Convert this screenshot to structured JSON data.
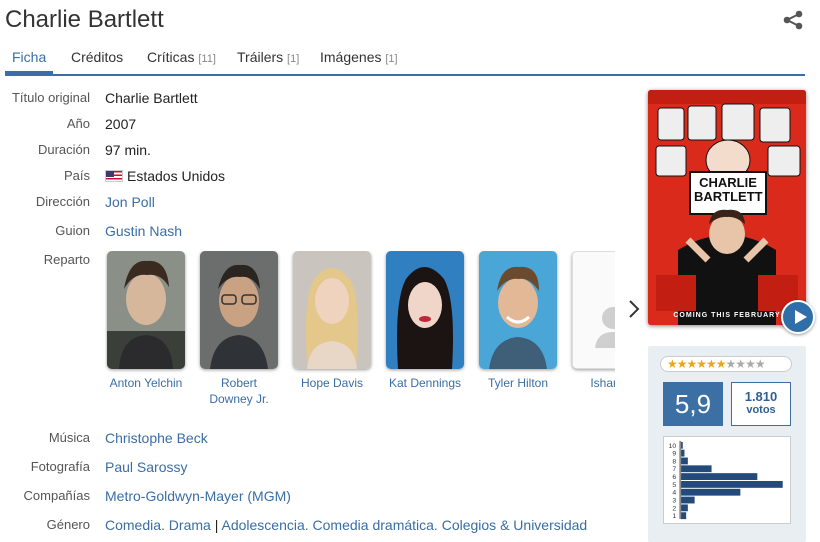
{
  "title": "Charlie Bartlett",
  "tabs": [
    {
      "label": "Ficha",
      "count": ""
    },
    {
      "label": "Créditos",
      "count": ""
    },
    {
      "label": "Críticas",
      "count": "[11]"
    },
    {
      "label": "Tráilers",
      "count": "[1]"
    },
    {
      "label": "Imágenes",
      "count": "[1]"
    }
  ],
  "fields": {
    "titulo_original": {
      "label": "Título original",
      "value": "Charlie Bartlett"
    },
    "anio": {
      "label": "Año",
      "value": "2007"
    },
    "duracion": {
      "label": "Duración",
      "value": "97 min."
    },
    "pais": {
      "label": "País",
      "value": "Estados Unidos"
    },
    "direccion": {
      "label": "Dirección",
      "value": "Jon Poll"
    },
    "guion": {
      "label": "Guion",
      "value": "Gustin Nash"
    },
    "reparto": {
      "label": "Reparto"
    },
    "musica": {
      "label": "Música",
      "value": "Christophe Beck"
    },
    "fotografia": {
      "label": "Fotografía",
      "value": "Paul Sarossy"
    },
    "companias": {
      "label": "Compañías",
      "value": "Metro-Goldwyn-Mayer (MGM)"
    },
    "genero": {
      "label": "Género",
      "value_a": "Comedia. Drama",
      "sep": " | ",
      "value_b": "Adolescencia. Comedia dramática. Colegios & Universidad"
    }
  },
  "cast": [
    {
      "name": "Anton Yelchin"
    },
    {
      "name": "Robert Downey Jr."
    },
    {
      "name": "Hope Davis"
    },
    {
      "name": "Kat Dennings"
    },
    {
      "name": "Tyler Hilton"
    },
    {
      "name": "Ishan D"
    }
  ],
  "poster": {
    "title_line1": "CHARLIE",
    "title_line2": "BARTLETT",
    "tagline": "COMING THIS FEBRUARY"
  },
  "rating": {
    "stars_on": "★★★★★★",
    "stars_off": "★★★★",
    "score": "5,9",
    "votes": "1.810",
    "votes_label": "votos",
    "histogram": {
      "labels": [
        "10",
        "9",
        "8",
        "7",
        "6",
        "5",
        "4",
        "3",
        "2",
        "1"
      ],
      "values": [
        1,
        2,
        4,
        18,
        45,
        60,
        35,
        8,
        4,
        3
      ]
    }
  },
  "colors": {
    "accent": "#3a6ea5",
    "score_bg": "#3c6fa3",
    "poster_red": "#d92a1c"
  }
}
